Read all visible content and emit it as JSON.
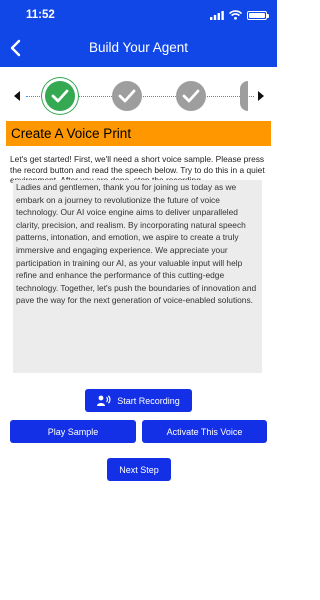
{
  "status_bar": {
    "time": "11:52"
  },
  "header": {
    "title": "Build Your Agent"
  },
  "stepper": {
    "icons": [
      "chevron-left-icon",
      "checkmark-icon",
      "checkmark-icon",
      "checkmark-icon",
      "chevron-right-icon"
    ],
    "step_colors": {
      "active": "#35a852",
      "done": "#9e9e9e",
      "connector": "#1e90ff"
    }
  },
  "section": {
    "title": "Create A Voice Print"
  },
  "instructions": "Let's get started! First, we'll need a short voice sample. Please press the record button and read the speech below. Try to do this in a quiet environment. After you are done, stop the recording.",
  "script_text": "Ladies and gentlemen, thank you for joining us today as we embark on a journey to revolutionize the future of voice technology. Our AI voice engine aims to deliver unparalleled clarity, precision, and realism. By incorporating natural speech patterns, intonation, and emotion, we aspire to create a truly immersive and engaging experience. We appreciate your participation in training our AI, as your valuable input will help refine and enhance the performance of this cutting-edge technology. Together, let's push the boundaries of innovation and pave the way for the next generation of voice-enabled solutions.",
  "buttons": {
    "start_recording": "Start Recording",
    "play_sample": "Play Sample",
    "activate_voice": "Activate This Voice",
    "next_step": "Next Step"
  },
  "colors": {
    "header": "#1147e6",
    "section_title_bg": "#ff9800",
    "button": "#1330e6"
  }
}
